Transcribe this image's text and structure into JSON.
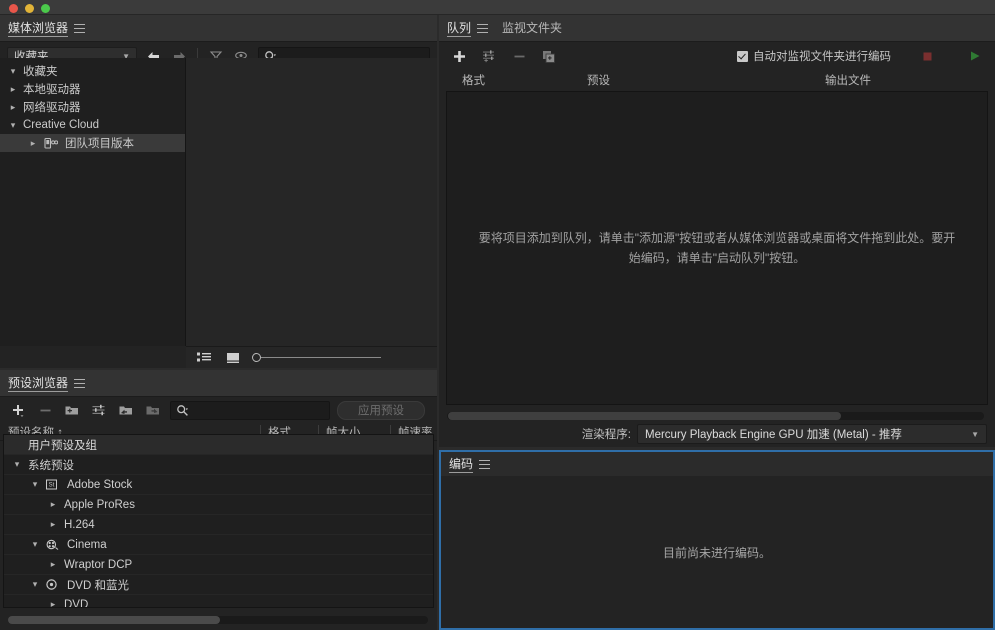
{
  "window": {
    "traffic_lights": [
      "close",
      "minimize",
      "maximize"
    ]
  },
  "media_browser": {
    "tab_label": "媒体浏览器",
    "location_dropdown": {
      "value": "收藏夹"
    },
    "toolbar": {
      "back": "back-arrow",
      "forward": "forward-arrow",
      "filter": "filter-icon",
      "eye": "eye-icon",
      "search_placeholder": "",
      "search_value": ""
    },
    "tree": [
      {
        "label": "收藏夹",
        "indent": 0,
        "state": "open",
        "icon": "",
        "selected": false
      },
      {
        "label": "本地驱动器",
        "indent": 0,
        "state": "closed",
        "icon": "",
        "selected": false
      },
      {
        "label": "网络驱动器",
        "indent": 0,
        "state": "closed",
        "icon": "",
        "selected": false
      },
      {
        "label": "Creative Cloud",
        "indent": 0,
        "state": "open",
        "icon": "",
        "selected": false
      },
      {
        "label": "团队项目版本",
        "indent": 1,
        "state": "closed",
        "icon": "team-project-icon",
        "selected": true
      }
    ],
    "footer": {
      "list_view": "list-view-icon",
      "thumbnail_view": "thumbnail-view-icon",
      "zoom_value": "0"
    }
  },
  "preset_browser": {
    "tab_label": "预设浏览器",
    "toolbar": {
      "new_preset": "new-preset-icon",
      "delete_preset": "delete-preset-icon",
      "new_folder": "new-folder-icon",
      "preset_settings": "preset-settings-icon",
      "import_preset": "import-preset-icon",
      "export_preset": "export-preset-icon",
      "search_value": "",
      "apply_label": "应用预设"
    },
    "columns": [
      "预设名称 ↑",
      "格式",
      "帧大小",
      "帧速率"
    ],
    "rows": [
      {
        "label": "用户预设及组",
        "indent": 0,
        "state": "none",
        "icon": "",
        "header": true
      },
      {
        "label": "系统预设",
        "indent": 0,
        "state": "open",
        "icon": "",
        "header": false
      },
      {
        "label": "Adobe Stock",
        "indent": 1,
        "state": "open",
        "icon": "adobe-stock-icon",
        "header": false
      },
      {
        "label": "Apple ProRes",
        "indent": 2,
        "state": "closed",
        "icon": "",
        "header": false
      },
      {
        "label": "H.264",
        "indent": 2,
        "state": "closed",
        "icon": "",
        "header": false
      },
      {
        "label": "Cinema",
        "indent": 1,
        "state": "open",
        "icon": "cinema-icon",
        "header": false
      },
      {
        "label": "Wraptor DCP",
        "indent": 2,
        "state": "closed",
        "icon": "",
        "header": false
      },
      {
        "label": "DVD 和蓝光",
        "indent": 1,
        "state": "open",
        "icon": "disc-icon",
        "header": false
      },
      {
        "label": "DVD",
        "indent": 2,
        "state": "closed",
        "icon": "",
        "header": false
      }
    ]
  },
  "queue": {
    "tabs": [
      {
        "label": "队列",
        "active": true
      },
      {
        "label": "监视文件夹",
        "active": false
      }
    ],
    "toolbar": {
      "add_source": "plus-icon",
      "preset_settings": "queue-preset-icon",
      "remove": "minus-icon",
      "duplicate": "duplicate-icon",
      "auto_encode_label": "自动对监视文件夹进行编码",
      "auto_encode_checked": true,
      "stop_button": "stop-icon",
      "start_button": "play-icon"
    },
    "columns": [
      "格式",
      "预设",
      "输出文件"
    ],
    "empty_message": "要将项目添加到队列，请单击\"添加源\"按钮或者从媒体浏览器或桌面将文件拖到此处。要开始编码，请单击\"启动队列\"按钮。",
    "renderer": {
      "label": "渲染程序:",
      "value": "Mercury Playback Engine GPU 加速 (Metal) - 推荐"
    }
  },
  "encoding": {
    "tab_label": "编码",
    "empty_message": "目前尚未进行编码。"
  },
  "colors": {
    "panel_bg": "#232323",
    "tabstrip_bg": "#333333",
    "focus_border": "#2f6ea8",
    "stop_red": "#7a2f2f",
    "play_green": "#2f7a33"
  }
}
